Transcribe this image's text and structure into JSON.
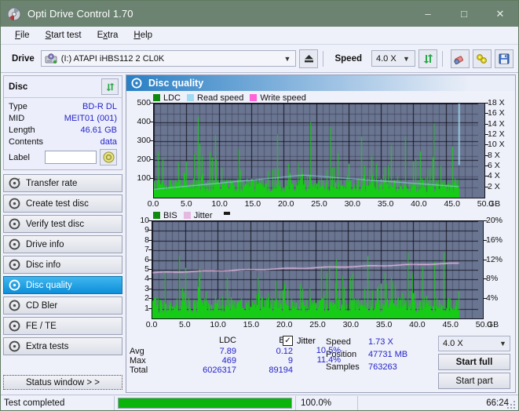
{
  "window": {
    "title": "Opti Drive Control 1.70",
    "icon": "disc-icon",
    "minimize": "–",
    "maximize": "□",
    "close": "✕"
  },
  "menu": [
    {
      "label": "File",
      "accel": "F"
    },
    {
      "label": "Start test",
      "accel": "S"
    },
    {
      "label": "Extra",
      "accel": "x"
    },
    {
      "label": "Help",
      "accel": "H"
    }
  ],
  "toolbar": {
    "drive_label": "Drive",
    "drive_value": "(I:)  ATAPI iHBS112  2 CL0K",
    "eject_icon": "eject-icon",
    "speed_label": "Speed",
    "speed_value": "4.0 X",
    "refresh_icon": "refresh-icon",
    "erase_icon": "eraser-icon",
    "tools_icon": "tools-icon",
    "save_icon": "save-icon"
  },
  "disc": {
    "title": "Disc",
    "refresh_icon": "refresh-icon",
    "rows": [
      {
        "key": "Type",
        "value": "BD-R DL"
      },
      {
        "key": "MID",
        "value": "MEIT01 (001)"
      },
      {
        "key": "Length",
        "value": "46.61 GB"
      },
      {
        "key": "Contents",
        "value": "data"
      }
    ],
    "label_key": "Label",
    "label_value": "",
    "label_icon": "disc-icon"
  },
  "nav": {
    "items": [
      {
        "label": "Transfer rate",
        "icon": "disc-transfer-icon",
        "active": false
      },
      {
        "label": "Create test disc",
        "icon": "disc-create-icon",
        "active": false
      },
      {
        "label": "Verify test disc",
        "icon": "disc-verify-icon",
        "active": false
      },
      {
        "label": "Drive info",
        "icon": "disc-drive-icon",
        "active": false
      },
      {
        "label": "Disc info",
        "icon": "disc-info-icon",
        "active": false
      },
      {
        "label": "Disc quality",
        "icon": "disc-quality-icon",
        "active": true
      },
      {
        "label": "CD Bler",
        "icon": "disc-bler-icon",
        "active": false
      },
      {
        "label": "FE / TE",
        "icon": "disc-fete-icon",
        "active": false
      },
      {
        "label": "Extra tests",
        "icon": "disc-extra-icon",
        "active": false
      }
    ],
    "status_window": "Status window > >"
  },
  "panel": {
    "title": "Disc quality",
    "icon": "disc-quality-icon"
  },
  "stats": {
    "col_headers": [
      "LDC",
      "BIS"
    ],
    "rows": [
      {
        "key": "Avg",
        "ldc": "7.89",
        "bis": "0.12",
        "jitter": "10.5%"
      },
      {
        "key": "Max",
        "ldc": "469",
        "bis": "9",
        "jitter": "11.4%"
      },
      {
        "key": "Total",
        "ldc": "6026317",
        "bis": "89194",
        "jitter": ""
      }
    ],
    "jitter_label": "Jitter",
    "jitter_checked": "✓",
    "speed_key": "Speed",
    "speed_value": "1.73 X",
    "position_key": "Position",
    "position_value": "47731 MB",
    "samples_key": "Samples",
    "samples_value": "763263",
    "select_speed": "4.0 X",
    "start_full": "Start full",
    "start_part": "Start part"
  },
  "statusbar": {
    "text": "Test completed",
    "percent": "100.0%",
    "progress": 100,
    "time": "66:24"
  },
  "colors": {
    "title_bar": "#6b8370",
    "plot_bg": "#6a7591",
    "ldc_green": "#16cc16",
    "read_speed": "#9fdcf2",
    "write_speed": "#ff63d8",
    "bis_green": "#16cc16",
    "jitter_pink": "#e5b8e0",
    "accent_blue": "#2424c8",
    "progress_green": "#0ab40a"
  },
  "chart_data": [
    {
      "type": "bar",
      "name": "top-chart",
      "title": "",
      "legend": [
        {
          "label": "LDC",
          "color": "#0f8a0f"
        },
        {
          "label": "Read speed",
          "color": "#9fdcf2"
        },
        {
          "label": "Write speed",
          "color": "#ff63d8"
        }
      ],
      "legend_position": "top-left",
      "xlabel": "GB",
      "xlim": [
        0,
        50
      ],
      "xticks": [
        0.0,
        5.0,
        10.0,
        15.0,
        20.0,
        25.0,
        30.0,
        35.0,
        40.0,
        45.0,
        50.0
      ],
      "xticklabels": [
        "0.0",
        "5.0",
        "10.0",
        "15.0",
        "20.0",
        "25.0",
        "30.0",
        "35.0",
        "40.0",
        "45.0",
        "50.0"
      ],
      "ylabel_left": "LDC",
      "ylim_left": [
        0,
        500
      ],
      "yticks_left": [
        100,
        200,
        300,
        400,
        500
      ],
      "ylabel_right": "Speed",
      "ylim_right": [
        0,
        18
      ],
      "yticks_right": [
        2,
        4,
        6,
        8,
        10,
        12,
        14,
        16,
        18
      ],
      "yticklabels_right": [
        "2 X",
        "4 X",
        "6 X",
        "8 X",
        "10 X",
        "12 X",
        "14 X",
        "16 X",
        "18 X"
      ],
      "grid": true,
      "series": [
        {
          "name": "LDC",
          "type": "bar",
          "color": "#16cc16",
          "note": "dense spiky error bars across 0-47 GB, baseline ~40-90, frequent spikes 200-470, max 469"
        },
        {
          "name": "Read speed",
          "type": "line",
          "color": "#9fdcf2",
          "note": "rises from ~1.6X at 0GB to ~4.3X around 23GB then falls to ~2.1X at 47GB; vertical jump to 18X at 47GB"
        },
        {
          "name": "Write speed",
          "type": "line",
          "color": "#ff63d8",
          "note": "not plotted"
        }
      ],
      "data_end_gb": 47.0
    },
    {
      "type": "bar",
      "name": "bottom-chart",
      "title": "",
      "legend": [
        {
          "label": "BIS",
          "color": "#0f8a0f"
        },
        {
          "label": "Jitter",
          "color": "#e5b8e0"
        }
      ],
      "legend_position": "top-left",
      "xlabel": "GB",
      "xlim": [
        0,
        50
      ],
      "xticks": [
        0.0,
        5.0,
        10.0,
        15.0,
        20.0,
        25.0,
        30.0,
        35.0,
        40.0,
        45.0,
        50.0
      ],
      "xticklabels": [
        "0.0",
        "5.0",
        "10.0",
        "15.0",
        "20.0",
        "25.0",
        "30.0",
        "35.0",
        "40.0",
        "45.0",
        "50.0"
      ],
      "ylabel_left": "BIS",
      "ylim_left": [
        0,
        10
      ],
      "yticks_left": [
        1,
        2,
        3,
        4,
        5,
        6,
        7,
        8,
        9,
        10
      ],
      "ylabel_right": "Jitter",
      "ylim_right": [
        0,
        20
      ],
      "yticks_right": [
        4,
        8,
        12,
        16,
        20
      ],
      "yticklabels_right": [
        "4%",
        "8%",
        "12%",
        "16%",
        "20%"
      ],
      "grid": true,
      "series": [
        {
          "name": "BIS",
          "type": "bar",
          "color": "#16cc16",
          "note": "dense bars baseline ~1-2, many spikes 3-9, max 9"
        },
        {
          "name": "Jitter",
          "type": "line",
          "color": "#e5b8e0",
          "note": "smooth line rising from ~9.4% (4.7 on left scale) at 0GB to ~11.3% (5.65) at 47GB"
        }
      ],
      "data_end_gb": 47.0
    }
  ]
}
